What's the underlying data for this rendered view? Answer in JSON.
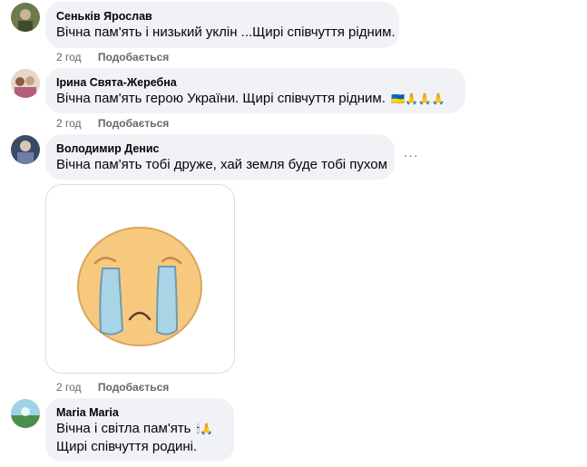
{
  "comments": [
    {
      "author": "Сеньків Ярослав",
      "text": "Вічна пам'ять і низький уклін ...Щирі співчуття рідним.",
      "time": "2 год",
      "like_label": "Подобається"
    },
    {
      "author": "Ірина Свята-Жеребна",
      "text": "Вічна пам'ять герою України. Щирі співчуття рідним.",
      "emojis": "🇺🇦🙏🙏🙏",
      "time": "2 год",
      "like_label": "Подобається"
    },
    {
      "author": "Володимир Денис",
      "text": "Вічна пам'ять тобі друже, хай земля буде тобі пухом",
      "more_label": "···",
      "time": "2 год",
      "like_label": "Подобається"
    },
    {
      "author": "Maria Maria",
      "text_line1": "Вічна і світла пам'ять",
      "emojis": "🕯🙏",
      "text_line2": "Щирі співчуття родині.",
      "time": "2 год",
      "like_label": "Подобається"
    }
  ],
  "sticker": {
    "name": "crying-face-sticker"
  },
  "colors": {
    "bubble_bg": "#f0f2f5",
    "meta_text": "#65676b",
    "sticker_face": "#f7c97e",
    "sticker_tears": "#a8d4e6"
  }
}
